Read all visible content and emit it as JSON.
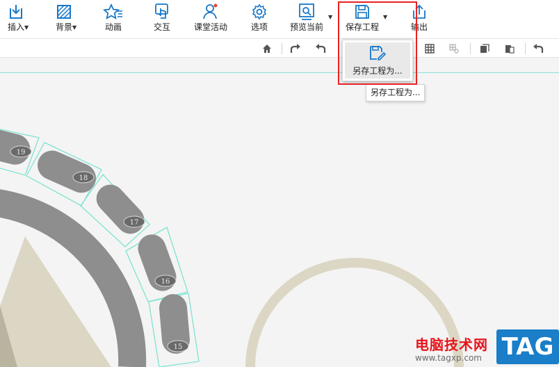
{
  "toolbar": {
    "items": [
      {
        "label": "插入",
        "icon": "insert-icon",
        "dropdown": true
      },
      {
        "label": "背景",
        "icon": "background-icon",
        "dropdown": true
      },
      {
        "label": "动画",
        "icon": "animation-icon",
        "dropdown": false
      },
      {
        "label": "交互",
        "icon": "interaction-icon",
        "dropdown": false
      },
      {
        "label": "课堂活动",
        "icon": "class-activity-icon",
        "dropdown": false
      },
      {
        "label": "选项",
        "icon": "gear-icon",
        "dropdown": false
      },
      {
        "label": "预览当前",
        "icon": "preview-icon",
        "dropdown": true
      },
      {
        "label": "保存工程",
        "icon": "save-icon",
        "dropdown": true
      },
      {
        "label": "输出",
        "icon": "export-icon",
        "dropdown": false
      }
    ],
    "accent_color": "#1677c8"
  },
  "save_menu": {
    "item_label": "另存工程为...",
    "item_icon": "save-as-icon",
    "tooltip": "另存工程为..."
  },
  "canvas": {
    "segments": [
      "19",
      "18",
      "17",
      "16",
      "15"
    ],
    "guide_color": "#8de0d4"
  },
  "watermark": {
    "text": "电脑技术网",
    "url": "www.tagxp.com",
    "tag": "TAG"
  }
}
